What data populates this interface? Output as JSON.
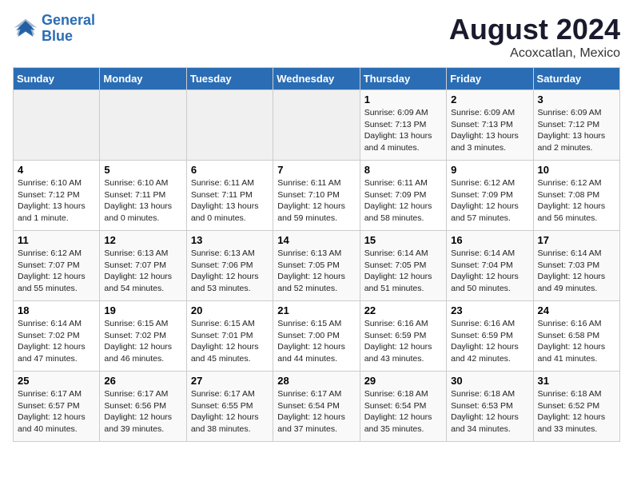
{
  "header": {
    "logo_line1": "General",
    "logo_line2": "Blue",
    "title": "August 2024",
    "subtitle": "Acoxcatlan, Mexico"
  },
  "days_of_week": [
    "Sunday",
    "Monday",
    "Tuesday",
    "Wednesday",
    "Thursday",
    "Friday",
    "Saturday"
  ],
  "weeks": [
    [
      {
        "day": "",
        "empty": true
      },
      {
        "day": "",
        "empty": true
      },
      {
        "day": "",
        "empty": true
      },
      {
        "day": "",
        "empty": true
      },
      {
        "day": "1",
        "sunrise": "6:09 AM",
        "sunset": "7:13 PM",
        "daylight": "13 hours and 4 minutes."
      },
      {
        "day": "2",
        "sunrise": "6:09 AM",
        "sunset": "7:13 PM",
        "daylight": "13 hours and 3 minutes."
      },
      {
        "day": "3",
        "sunrise": "6:09 AM",
        "sunset": "7:12 PM",
        "daylight": "13 hours and 2 minutes."
      }
    ],
    [
      {
        "day": "4",
        "sunrise": "6:10 AM",
        "sunset": "7:12 PM",
        "daylight": "13 hours and 1 minute."
      },
      {
        "day": "5",
        "sunrise": "6:10 AM",
        "sunset": "7:11 PM",
        "daylight": "13 hours and 0 minutes."
      },
      {
        "day": "6",
        "sunrise": "6:11 AM",
        "sunset": "7:11 PM",
        "daylight": "13 hours and 0 minutes."
      },
      {
        "day": "7",
        "sunrise": "6:11 AM",
        "sunset": "7:10 PM",
        "daylight": "12 hours and 59 minutes."
      },
      {
        "day": "8",
        "sunrise": "6:11 AM",
        "sunset": "7:09 PM",
        "daylight": "12 hours and 58 minutes."
      },
      {
        "day": "9",
        "sunrise": "6:12 AM",
        "sunset": "7:09 PM",
        "daylight": "12 hours and 57 minutes."
      },
      {
        "day": "10",
        "sunrise": "6:12 AM",
        "sunset": "7:08 PM",
        "daylight": "12 hours and 56 minutes."
      }
    ],
    [
      {
        "day": "11",
        "sunrise": "6:12 AM",
        "sunset": "7:07 PM",
        "daylight": "12 hours and 55 minutes."
      },
      {
        "day": "12",
        "sunrise": "6:13 AM",
        "sunset": "7:07 PM",
        "daylight": "12 hours and 54 minutes."
      },
      {
        "day": "13",
        "sunrise": "6:13 AM",
        "sunset": "7:06 PM",
        "daylight": "12 hours and 53 minutes."
      },
      {
        "day": "14",
        "sunrise": "6:13 AM",
        "sunset": "7:05 PM",
        "daylight": "12 hours and 52 minutes."
      },
      {
        "day": "15",
        "sunrise": "6:14 AM",
        "sunset": "7:05 PM",
        "daylight": "12 hours and 51 minutes."
      },
      {
        "day": "16",
        "sunrise": "6:14 AM",
        "sunset": "7:04 PM",
        "daylight": "12 hours and 50 minutes."
      },
      {
        "day": "17",
        "sunrise": "6:14 AM",
        "sunset": "7:03 PM",
        "daylight": "12 hours and 49 minutes."
      }
    ],
    [
      {
        "day": "18",
        "sunrise": "6:14 AM",
        "sunset": "7:02 PM",
        "daylight": "12 hours and 47 minutes."
      },
      {
        "day": "19",
        "sunrise": "6:15 AM",
        "sunset": "7:02 PM",
        "daylight": "12 hours and 46 minutes."
      },
      {
        "day": "20",
        "sunrise": "6:15 AM",
        "sunset": "7:01 PM",
        "daylight": "12 hours and 45 minutes."
      },
      {
        "day": "21",
        "sunrise": "6:15 AM",
        "sunset": "7:00 PM",
        "daylight": "12 hours and 44 minutes."
      },
      {
        "day": "22",
        "sunrise": "6:16 AM",
        "sunset": "6:59 PM",
        "daylight": "12 hours and 43 minutes."
      },
      {
        "day": "23",
        "sunrise": "6:16 AM",
        "sunset": "6:59 PM",
        "daylight": "12 hours and 42 minutes."
      },
      {
        "day": "24",
        "sunrise": "6:16 AM",
        "sunset": "6:58 PM",
        "daylight": "12 hours and 41 minutes."
      }
    ],
    [
      {
        "day": "25",
        "sunrise": "6:17 AM",
        "sunset": "6:57 PM",
        "daylight": "12 hours and 40 minutes."
      },
      {
        "day": "26",
        "sunrise": "6:17 AM",
        "sunset": "6:56 PM",
        "daylight": "12 hours and 39 minutes."
      },
      {
        "day": "27",
        "sunrise": "6:17 AM",
        "sunset": "6:55 PM",
        "daylight": "12 hours and 38 minutes."
      },
      {
        "day": "28",
        "sunrise": "6:17 AM",
        "sunset": "6:54 PM",
        "daylight": "12 hours and 37 minutes."
      },
      {
        "day": "29",
        "sunrise": "6:18 AM",
        "sunset": "6:54 PM",
        "daylight": "12 hours and 35 minutes."
      },
      {
        "day": "30",
        "sunrise": "6:18 AM",
        "sunset": "6:53 PM",
        "daylight": "12 hours and 34 minutes."
      },
      {
        "day": "31",
        "sunrise": "6:18 AM",
        "sunset": "6:52 PM",
        "daylight": "12 hours and 33 minutes."
      }
    ]
  ]
}
